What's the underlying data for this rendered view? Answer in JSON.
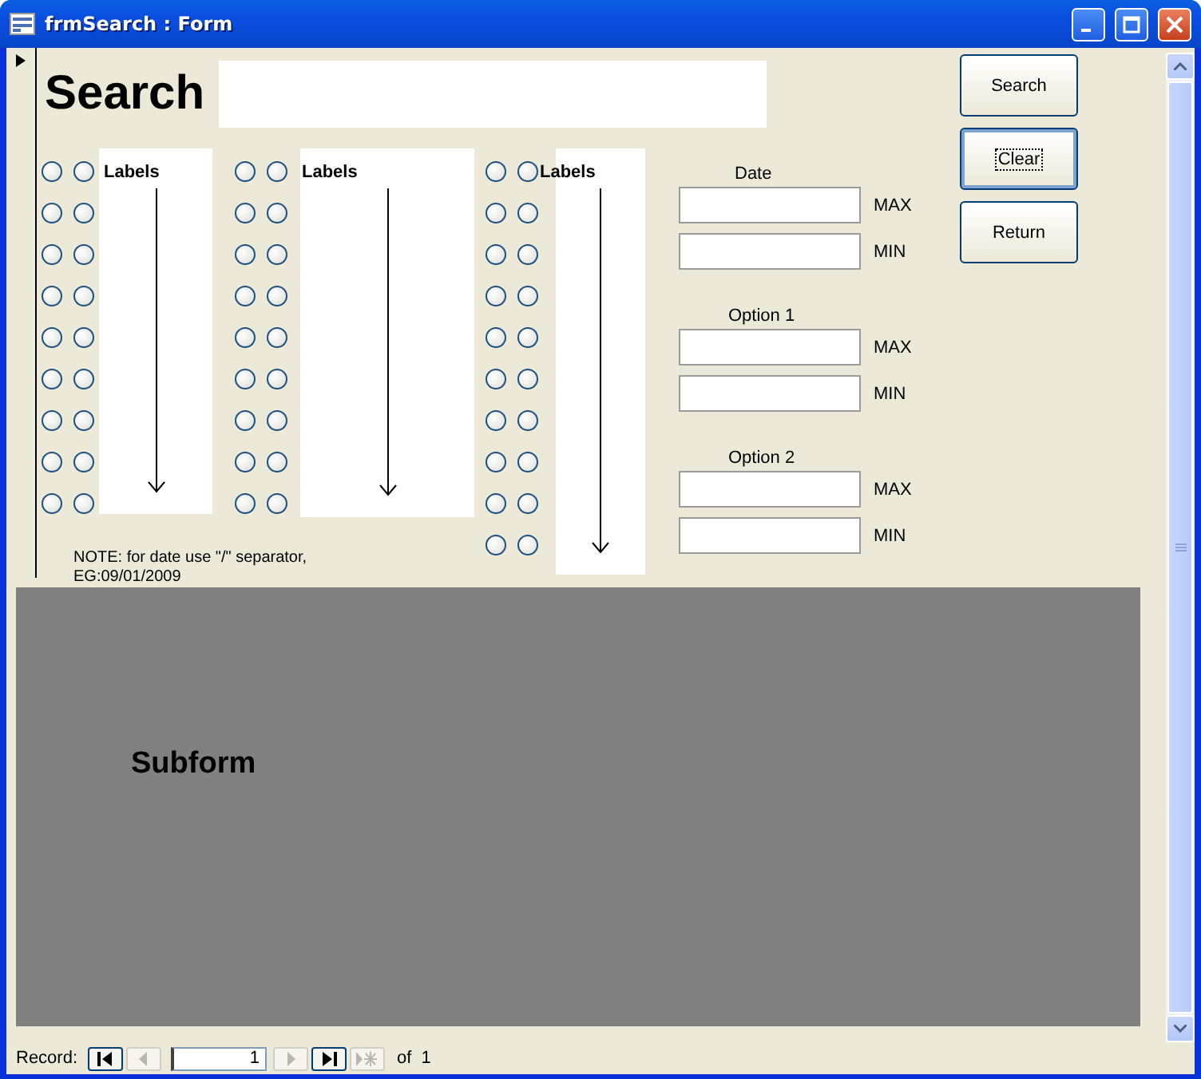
{
  "window": {
    "title": "frmSearch : Form"
  },
  "header": {
    "title": "Search"
  },
  "buttons": [
    {
      "label": "Search",
      "focused": false
    },
    {
      "label": "Clear",
      "focused": true
    },
    {
      "label": "Return",
      "focused": false
    }
  ],
  "radio_groups": [
    {
      "label": "Labels",
      "rows": [
        {
          "options": [
            {
              "selected": false
            },
            {
              "selected": false
            }
          ]
        },
        {
          "options": [
            {
              "selected": false
            },
            {
              "selected": false
            }
          ]
        },
        {
          "options": [
            {
              "selected": false
            },
            {
              "selected": false
            }
          ]
        },
        {
          "options": [
            {
              "selected": false
            },
            {
              "selected": false
            }
          ]
        },
        {
          "options": [
            {
              "selected": false
            },
            {
              "selected": false
            }
          ]
        },
        {
          "options": [
            {
              "selected": false
            },
            {
              "selected": false
            }
          ]
        },
        {
          "options": [
            {
              "selected": false
            },
            {
              "selected": false
            }
          ]
        },
        {
          "options": [
            {
              "selected": false
            },
            {
              "selected": false
            }
          ]
        },
        {
          "options": [
            {
              "selected": false
            },
            {
              "selected": false
            }
          ]
        }
      ]
    },
    {
      "label": "Labels",
      "rows": [
        {
          "options": [
            {
              "selected": false
            },
            {
              "selected": false
            }
          ]
        },
        {
          "options": [
            {
              "selected": false
            },
            {
              "selected": false
            }
          ]
        },
        {
          "options": [
            {
              "selected": false
            },
            {
              "selected": false
            }
          ]
        },
        {
          "options": [
            {
              "selected": false
            },
            {
              "selected": false
            }
          ]
        },
        {
          "options": [
            {
              "selected": false
            },
            {
              "selected": false
            }
          ]
        },
        {
          "options": [
            {
              "selected": false
            },
            {
              "selected": false
            }
          ]
        },
        {
          "options": [
            {
              "selected": false
            },
            {
              "selected": false
            }
          ]
        },
        {
          "options": [
            {
              "selected": false
            },
            {
              "selected": false
            }
          ]
        },
        {
          "options": [
            {
              "selected": false
            },
            {
              "selected": false
            }
          ]
        }
      ]
    },
    {
      "label": "Labels",
      "rows": [
        {
          "options": [
            {
              "selected": false
            },
            {
              "selected": false
            }
          ]
        },
        {
          "options": [
            {
              "selected": false
            },
            {
              "selected": false
            }
          ]
        },
        {
          "options": [
            {
              "selected": false
            },
            {
              "selected": false
            }
          ]
        },
        {
          "options": [
            {
              "selected": false
            },
            {
              "selected": false
            }
          ]
        },
        {
          "options": [
            {
              "selected": false
            },
            {
              "selected": false
            }
          ]
        },
        {
          "options": [
            {
              "selected": false
            },
            {
              "selected": false
            }
          ]
        },
        {
          "options": [
            {
              "selected": false
            },
            {
              "selected": false
            }
          ]
        },
        {
          "options": [
            {
              "selected": false
            },
            {
              "selected": false
            }
          ]
        },
        {
          "options": [
            {
              "selected": false
            },
            {
              "selected": false
            }
          ]
        },
        {
          "options": [
            {
              "selected": false
            },
            {
              "selected": false
            }
          ]
        }
      ]
    }
  ],
  "note": "NOTE: for date use \"/\" separator, EG:09/01/2009",
  "filters": [
    {
      "label": "Date",
      "max_label": "MAX",
      "min_label": "MIN"
    },
    {
      "label": "Option 1",
      "max_label": "MAX",
      "min_label": "MIN"
    },
    {
      "label": "Option 2",
      "max_label": "MAX",
      "min_label": "MIN"
    }
  ],
  "subform": {
    "label": "Subform"
  },
  "record_nav": {
    "label": "Record:",
    "current": "1",
    "of": "of",
    "total": "1"
  }
}
